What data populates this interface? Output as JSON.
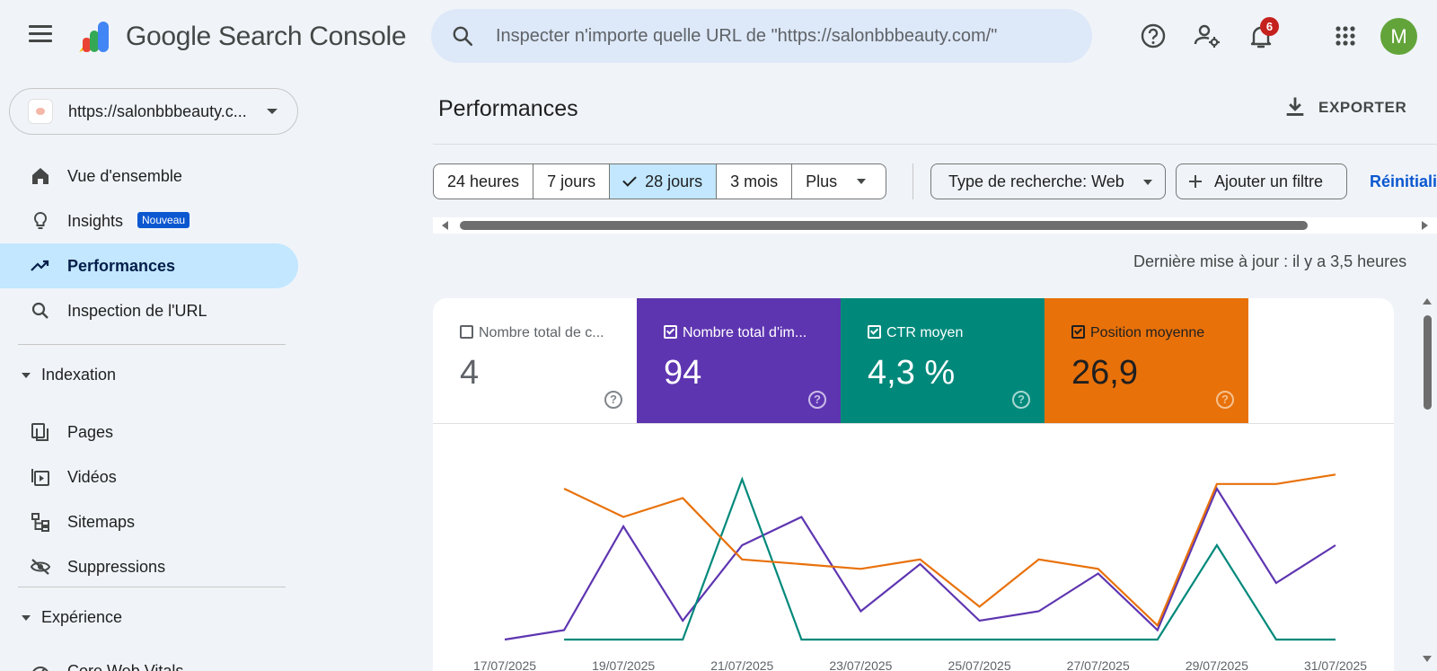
{
  "app": {
    "brand": "Google Search Console",
    "notifications_count": "6",
    "avatar_letter": "M"
  },
  "search": {
    "placeholder": "Inspecter n'importe quelle URL de \"https://salonbbbeauty.com/\""
  },
  "property": {
    "url": "https://salonbbbeauty.c..."
  },
  "sidebar": {
    "items": [
      {
        "label": "Vue d'ensemble",
        "icon": "home-icon"
      },
      {
        "label": "Insights",
        "icon": "lightbulb-icon",
        "badge": "Nouveau"
      },
      {
        "label": "Performances",
        "icon": "trending-up-icon",
        "active": true
      },
      {
        "label": "Inspection de l'URL",
        "icon": "search-icon"
      }
    ],
    "indexation": {
      "title": "Indexation",
      "items": [
        {
          "label": "Pages",
          "icon": "pages-icon"
        },
        {
          "label": "Vidéos",
          "icon": "video-icon"
        },
        {
          "label": "Sitemaps",
          "icon": "sitemap-icon"
        },
        {
          "label": "Suppressions",
          "icon": "eye-off-icon"
        }
      ]
    },
    "experience": {
      "title": "Expérience",
      "items": [
        {
          "label": "Core Web Vitals",
          "icon": "gauge-icon"
        }
      ]
    }
  },
  "main": {
    "title": "Performances",
    "export_label": "EXPORTER",
    "date_ranges": [
      "24 heures",
      "7 jours",
      "28 jours",
      "3 mois",
      "Plus"
    ],
    "selected_range": "28 jours",
    "search_type_chip": "Type de recherche: Web",
    "add_filter": "Ajouter un filtre",
    "reset": "Réinitialis",
    "last_updated": "Dernière mise à jour : il y a 3,5 heures"
  },
  "metrics": [
    {
      "label": "Nombre total de c...",
      "value": "4",
      "checked": false,
      "color": "#ffffff"
    },
    {
      "label": "Nombre total d'im...",
      "value": "94",
      "checked": true,
      "color": "#5e35b1"
    },
    {
      "label": "CTR moyen",
      "value": "4,3 %",
      "checked": true,
      "color": "#00897b"
    },
    {
      "label": "Position moyenne",
      "value": "26,9",
      "checked": true,
      "color": "#e8710a"
    }
  ],
  "chart_data": {
    "type": "line",
    "x": [
      "17/07/2025",
      "18/07/2025",
      "19/07/2025",
      "20/07/2025",
      "21/07/2025",
      "22/07/2025",
      "23/07/2025",
      "24/07/2025",
      "25/07/2025",
      "26/07/2025",
      "27/07/2025",
      "28/07/2025",
      "29/07/2025",
      "30/07/2025",
      "31/07/2025"
    ],
    "x_ticks": [
      "17/07/2025",
      "19/07/2025",
      "21/07/2025",
      "23/07/2025",
      "25/07/2025",
      "27/07/2025",
      "29/07/2025",
      "31/07/2025"
    ],
    "series": [
      {
        "name": "Nombre total d'im...",
        "color": "#5e35b1",
        "values": [
          0,
          1,
          12,
          2,
          10,
          13,
          3,
          8,
          2,
          3,
          7,
          1,
          16,
          6,
          10
        ]
      },
      {
        "name": "CTR moyen",
        "color": "#00897b",
        "values": [
          null,
          0,
          0,
          0,
          17,
          0,
          0,
          0,
          0,
          0,
          0,
          0,
          10,
          0,
          0
        ]
      },
      {
        "name": "Position moyenne",
        "color": "#e8710a",
        "values": [
          null,
          8,
          14,
          10,
          23,
          24,
          25,
          23,
          33,
          23,
          25,
          37,
          7,
          7,
          5
        ]
      }
    ],
    "grid": false
  }
}
